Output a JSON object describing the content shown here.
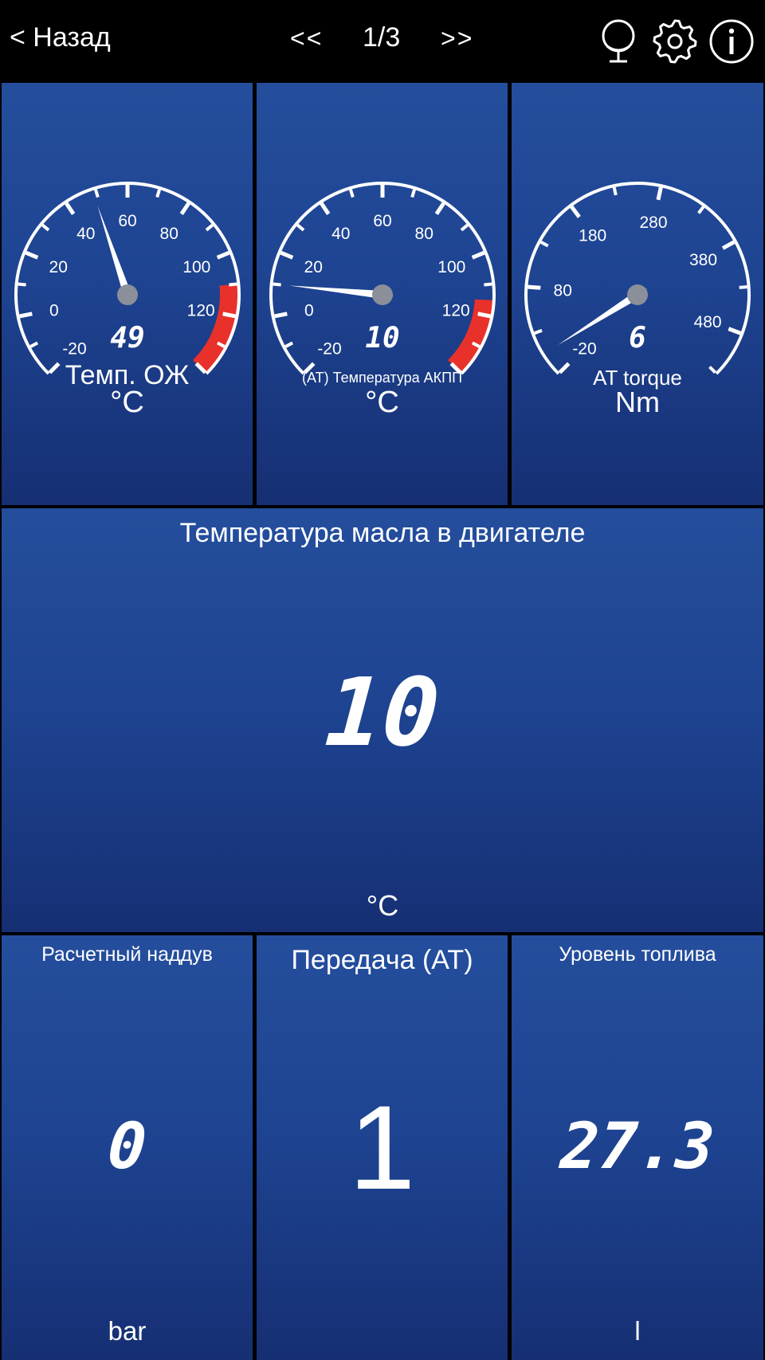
{
  "header": {
    "back_label": "< Назад",
    "prev_label": "<<",
    "page_indicator": "1/3",
    "next_label": ">>",
    "icons": [
      "microphone-icon",
      "gear-icon",
      "info-icon"
    ]
  },
  "colors": {
    "tile_top": "#244e9d",
    "tile_bottom": "#162f73",
    "redzone": "#e8312a",
    "needle_hub": "#8a8f99"
  },
  "gauges": [
    {
      "name": "coolant-temp",
      "title": "Темп. ОЖ",
      "unit": "°C",
      "value_text": "49",
      "value": 49,
      "min": -20,
      "max": 140,
      "labels": [
        "-20",
        "0",
        "20",
        "40",
        "60",
        "80",
        "100",
        "120"
      ],
      "redzone": [
        110,
        140
      ]
    },
    {
      "name": "at-fluid-temp",
      "title": "(AT) Температура АКПП",
      "unit": "°C",
      "value_text": "10",
      "value": 10,
      "min": -20,
      "max": 140,
      "labels": [
        "-20",
        "0",
        "20",
        "40",
        "60",
        "80",
        "100",
        "120"
      ],
      "redzone": [
        115,
        140
      ]
    },
    {
      "name": "at-torque",
      "title": "AT torque",
      "unit": "Nm",
      "value_text": "6",
      "value": 6,
      "min": -20,
      "max": 530,
      "labels": [
        "-20",
        "80",
        "180",
        "280",
        "380",
        "480"
      ],
      "redzone": null
    }
  ],
  "oil_temp": {
    "title": "Температура масла в двигателе",
    "value": "10",
    "unit": "°C"
  },
  "boost": {
    "title": "Расчетный наддув",
    "value": "0",
    "unit": "bar"
  },
  "gear": {
    "title": "Передача (AT)",
    "value": "1"
  },
  "fuel": {
    "title": "Уровень топлива",
    "value": "27.3",
    "unit": "l"
  }
}
